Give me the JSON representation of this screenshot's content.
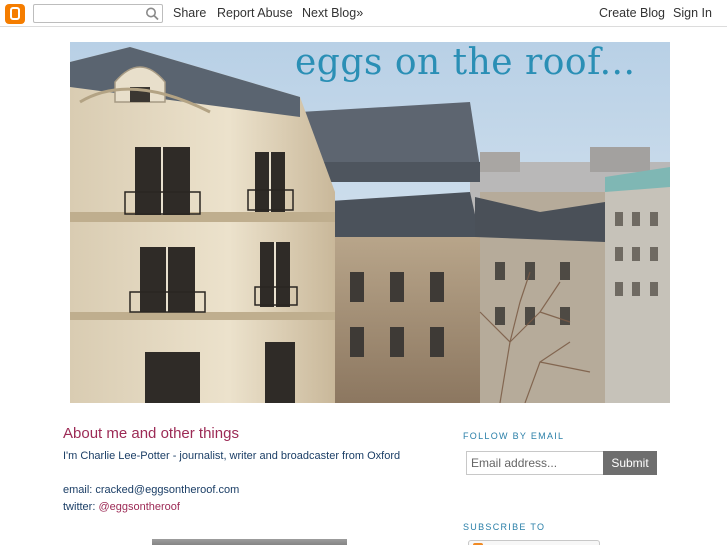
{
  "navbar": {
    "search_placeholder": "",
    "share": "Share",
    "report_abuse": "Report Abuse",
    "next_blog": "Next Blog»",
    "create_blog": "Create Blog",
    "sign_in": "Sign In"
  },
  "header": {
    "title": "eggs on the roof..."
  },
  "about": {
    "title": "About me and other things",
    "bio": "I'm Charlie Lee-Potter - journalist, writer and broadcaster from Oxford",
    "email": "email: cracked@eggsontheroof.com",
    "twitter_label": "twitter: ",
    "twitter_handle": "@eggsontheroof"
  },
  "sidebar": {
    "follow_heading": "Follow by Email",
    "email_placeholder": "Email address...",
    "submit": "Submit",
    "subscribe_heading": "Subscribe to"
  },
  "colors": {
    "accent_title": "#2a8fb5",
    "link": "#9c2a55",
    "body_text": "#1b3e66",
    "blogger_orange": "#f57d00"
  }
}
